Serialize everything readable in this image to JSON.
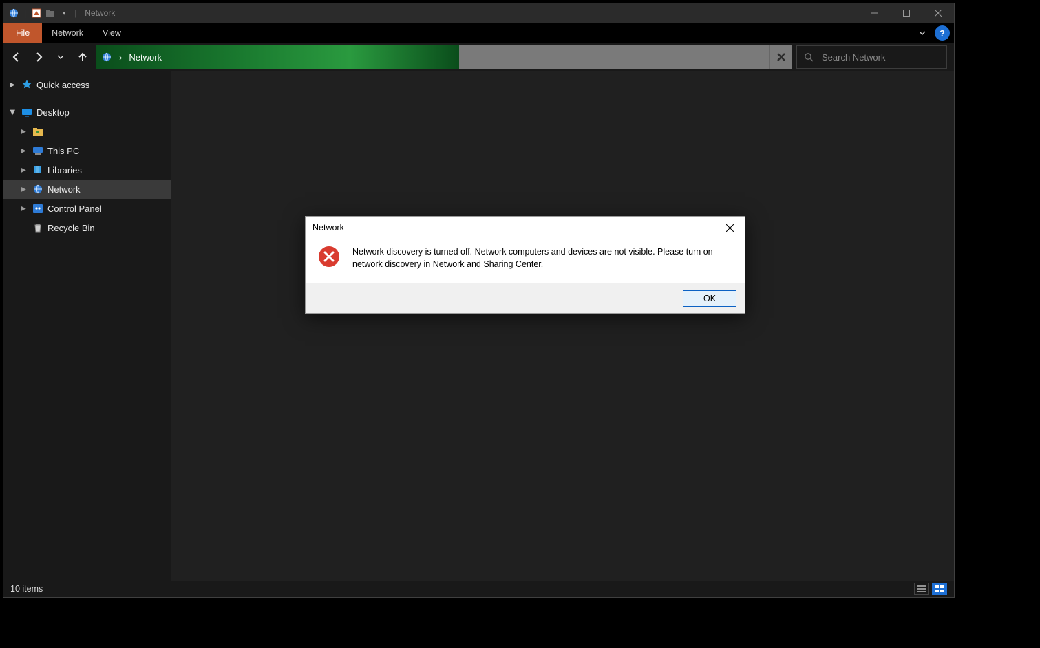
{
  "titlebar": {
    "title": "Network"
  },
  "ribbon": {
    "file": "File",
    "tabs": [
      "Network",
      "View"
    ]
  },
  "nav": {
    "breadcrumb": "Network",
    "search_placeholder": "Search Network"
  },
  "sidebar": {
    "quick_access": "Quick access",
    "desktop": "Desktop",
    "unnamed": "",
    "this_pc": "This PC",
    "libraries": "Libraries",
    "network": "Network",
    "control_panel": "Control Panel",
    "recycle_bin": "Recycle Bin"
  },
  "statusbar": {
    "items": "10 items"
  },
  "dialog": {
    "title": "Network",
    "message": "Network discovery is turned off. Network computers and devices are not visible. Please turn on network discovery in Network and Sharing Center.",
    "ok": "OK"
  }
}
